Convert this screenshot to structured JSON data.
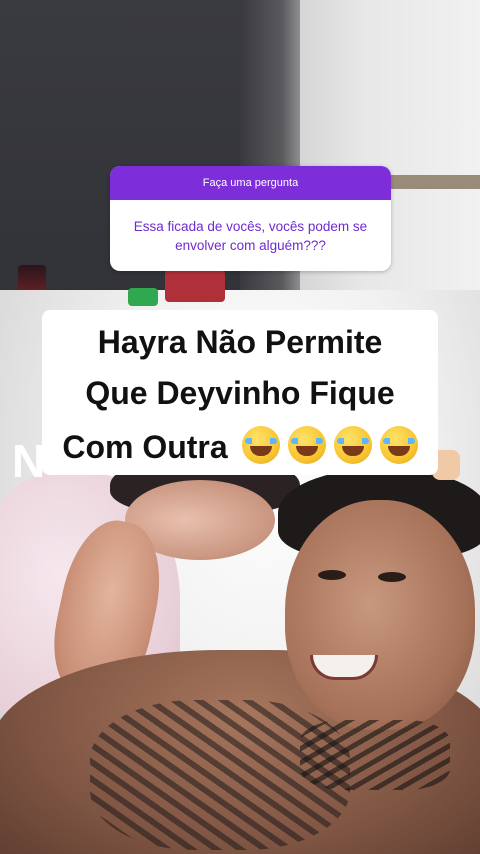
{
  "question_sticker": {
    "header": "Faça uma pergunta",
    "question": "Essa ficada de vocês, vocês podem se envolver com alguém???",
    "accent_color": "#7d2ed9"
  },
  "caption": {
    "line1": "Hayra Não Permite",
    "line2": "Que Deyvinho Fique",
    "line3": "Com Outra",
    "emoji_name": "face-with-tears-of-joy",
    "emoji_count": 4
  },
  "partial_overlay_letter": "N"
}
